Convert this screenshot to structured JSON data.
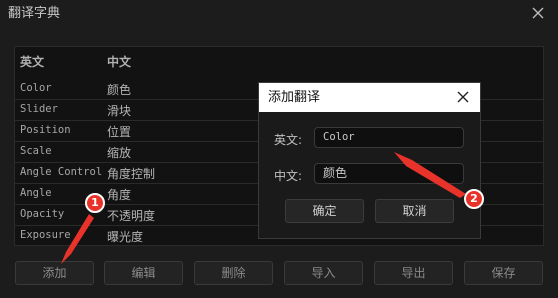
{
  "window": {
    "title": "翻译字典"
  },
  "table": {
    "headers": {
      "en": "英文",
      "zh": "中文"
    },
    "rows": [
      {
        "en": "Color",
        "zh": "颜色"
      },
      {
        "en": "Slider",
        "zh": "滑块"
      },
      {
        "en": "Position",
        "zh": "位置"
      },
      {
        "en": "Scale",
        "zh": "缩放"
      },
      {
        "en": "Angle Control",
        "zh": "角度控制"
      },
      {
        "en": "Angle",
        "zh": "角度"
      },
      {
        "en": "Opacity",
        "zh": "不透明度"
      },
      {
        "en": "Exposure",
        "zh": "曝光度"
      }
    ]
  },
  "toolbar": {
    "add": "添加",
    "edit": "编辑",
    "delete": "删除",
    "import": "导入",
    "export": "导出",
    "save": "保存"
  },
  "dialog": {
    "title": "添加翻译",
    "en_label": "英文:",
    "en_value": "Color",
    "zh_label": "中文:",
    "zh_value": "颜色",
    "ok": "确定",
    "cancel": "取消"
  },
  "annotations": {
    "badge1": "1",
    "badge2": "2",
    "color": "#e8332a"
  }
}
